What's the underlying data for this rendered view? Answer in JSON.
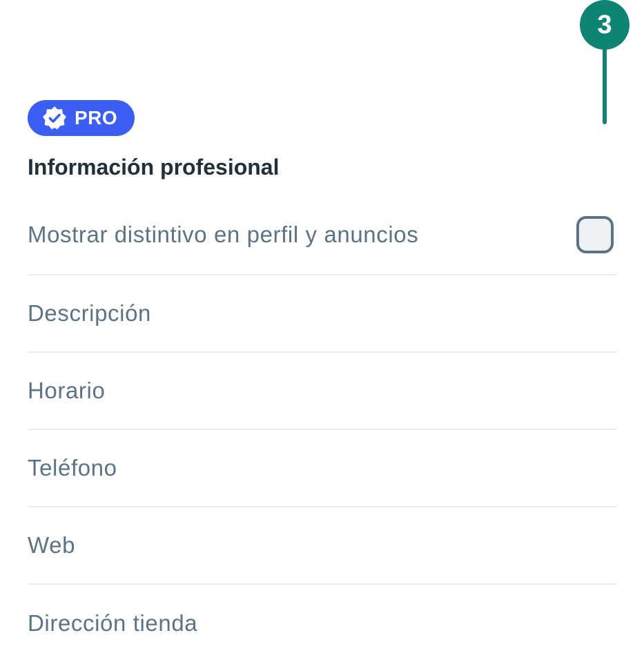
{
  "step_marker": {
    "number": "3",
    "color": "#0e8474"
  },
  "badge": {
    "icon": "verified-badge-icon",
    "label": "PRO",
    "color": "#3b5ff2"
  },
  "section": {
    "title": "Información profesional"
  },
  "settings": {
    "show_badge": {
      "label": "Mostrar distintivo en perfil y anuncios",
      "checked": false
    },
    "fields": [
      {
        "label": "Descripción"
      },
      {
        "label": "Horario"
      },
      {
        "label": "Teléfono"
      },
      {
        "label": "Web"
      },
      {
        "label": "Dirección tienda"
      }
    ]
  }
}
